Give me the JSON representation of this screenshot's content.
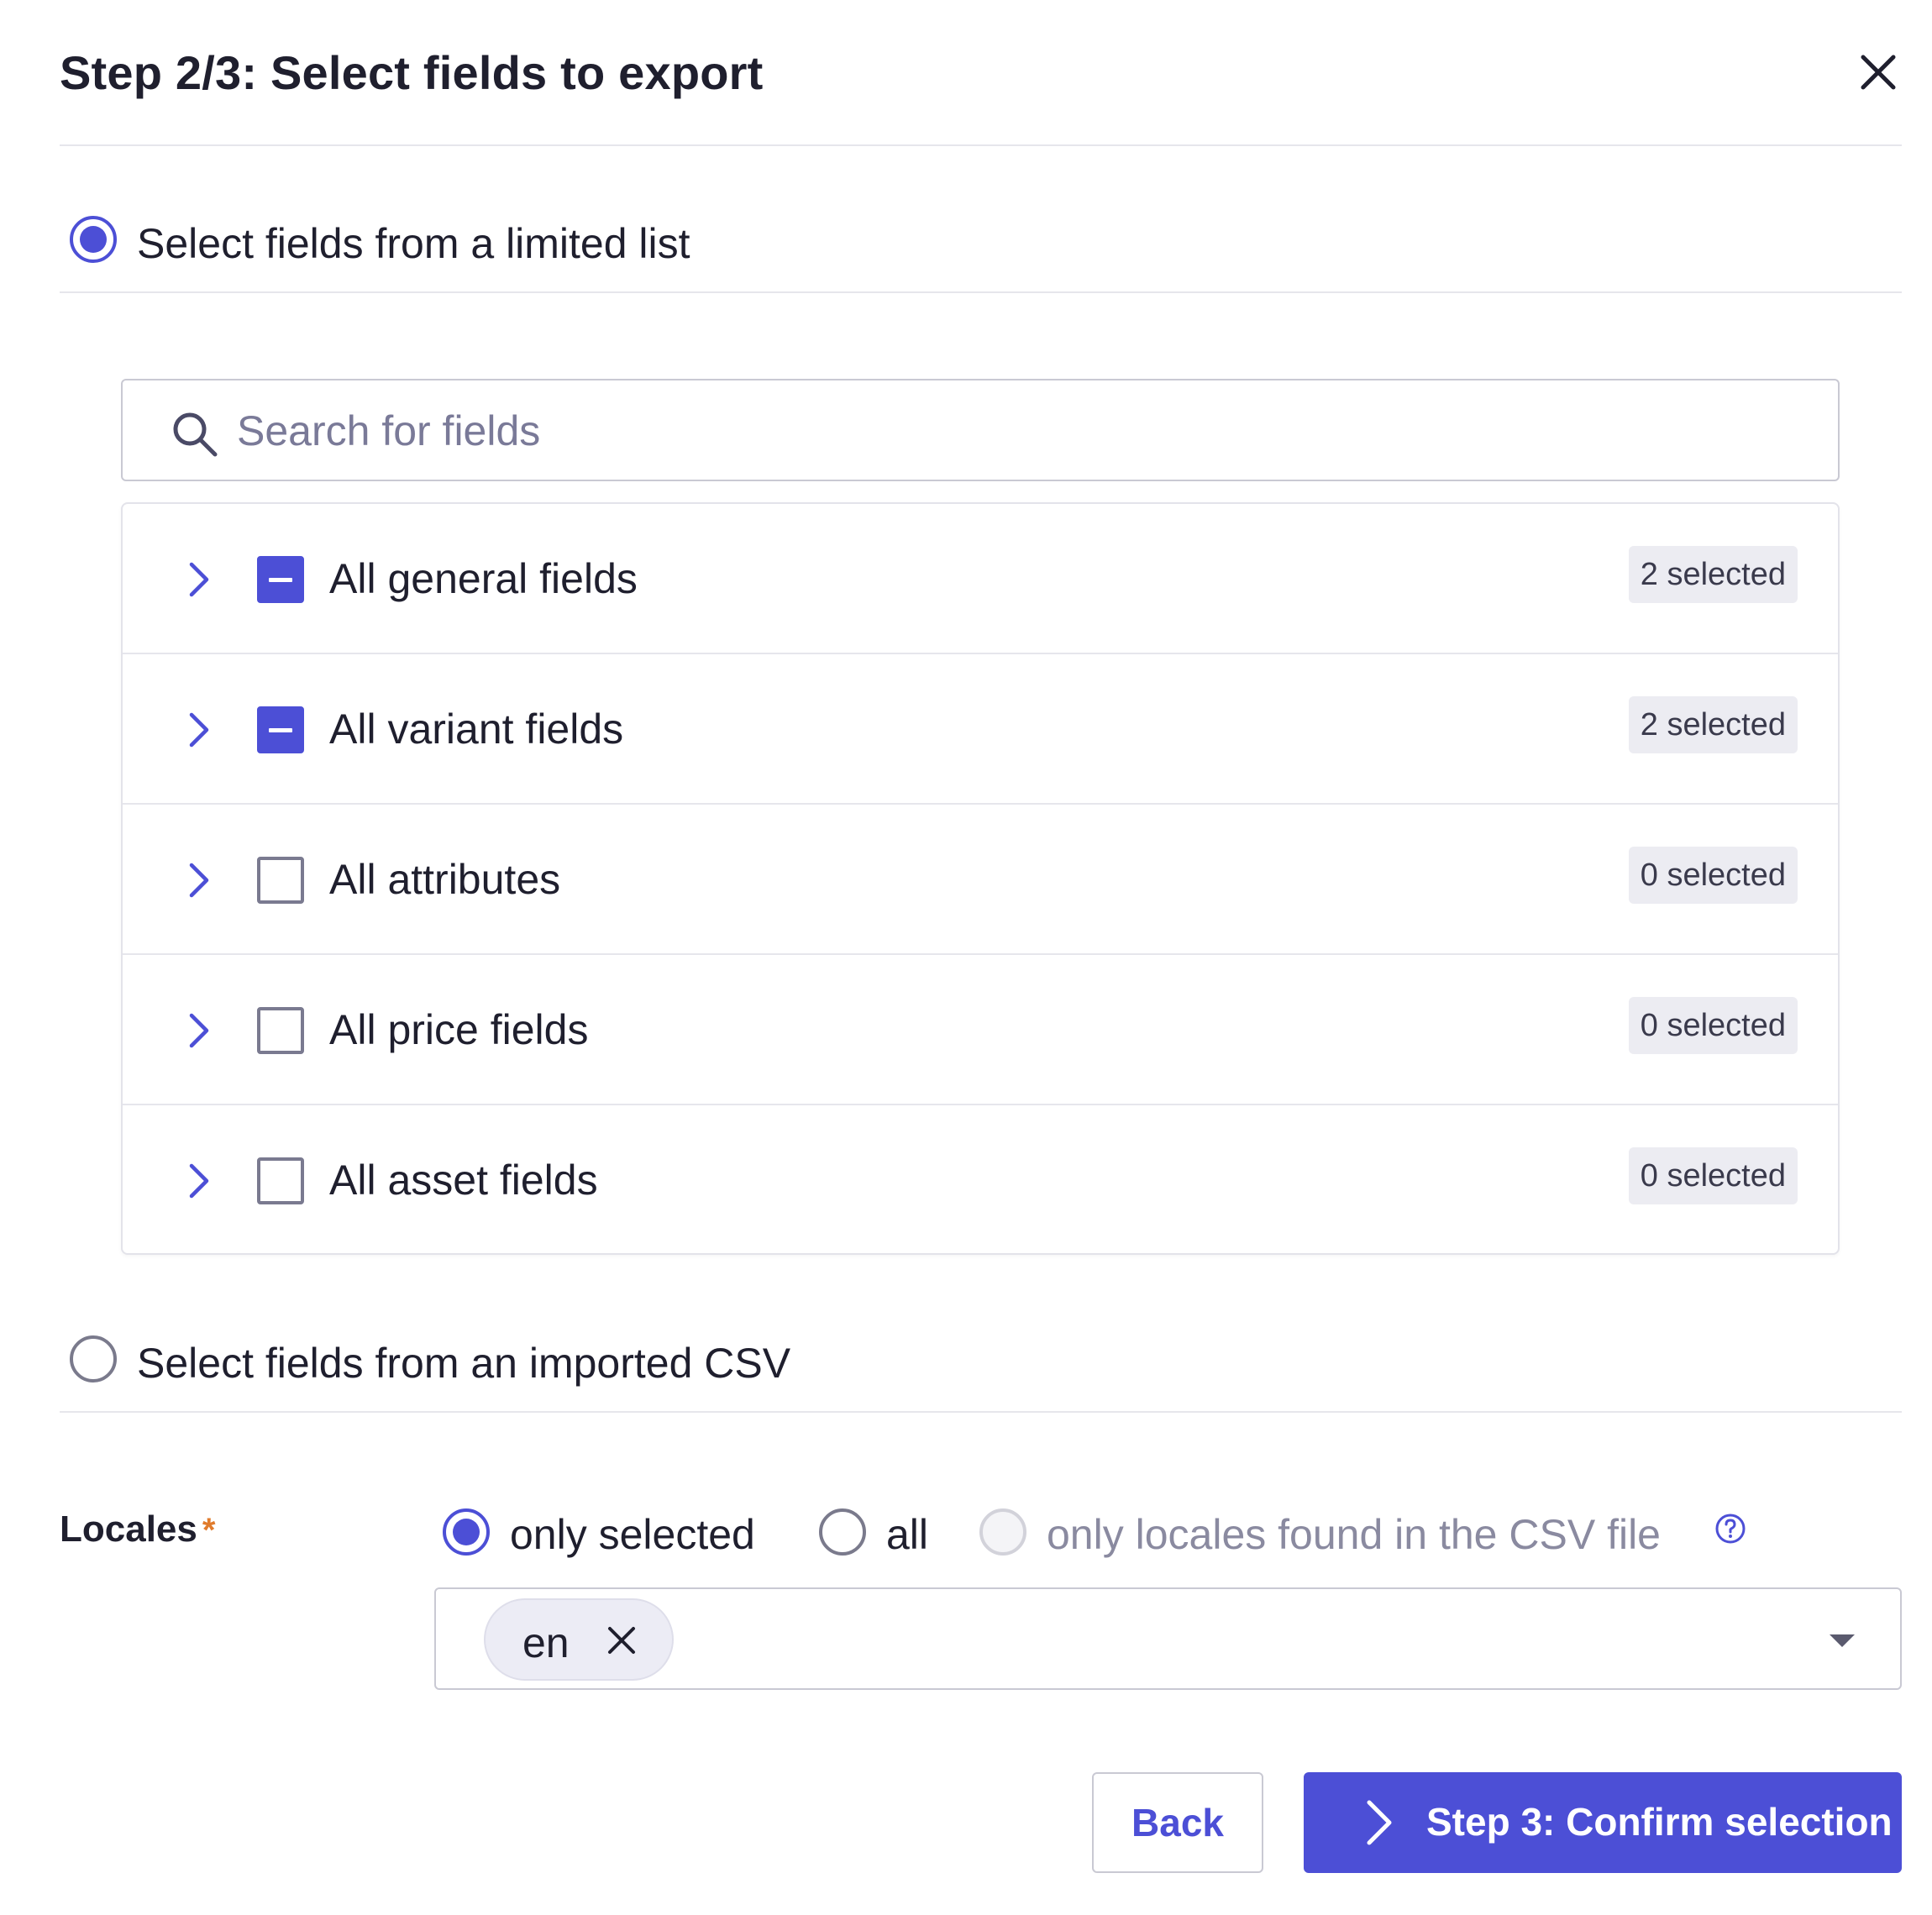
{
  "dialog": {
    "title": "Step 2/3: Select fields to export",
    "close_icon": "close-icon"
  },
  "mode_options": {
    "limited_list_label": "Select fields from a limited list",
    "limited_list_selected": true,
    "imported_csv_label": "Select fields from an imported CSV",
    "imported_csv_selected": false
  },
  "search": {
    "placeholder": "Search for fields",
    "value": "",
    "icon": "search-icon"
  },
  "field_groups": [
    {
      "label": "All general fields",
      "badge": "2 selected",
      "state": "partial"
    },
    {
      "label": "All variant fields",
      "badge": "2 selected",
      "state": "partial"
    },
    {
      "label": "All attributes",
      "badge": "0 selected",
      "state": "unchecked"
    },
    {
      "label": "All price fields",
      "badge": "0 selected",
      "state": "unchecked"
    },
    {
      "label": "All asset fields",
      "badge": "0 selected",
      "state": "unchecked"
    }
  ],
  "locales": {
    "label": "Locales",
    "required_mark": "*",
    "options": [
      {
        "label": "only selected",
        "selected": true,
        "disabled": false
      },
      {
        "label": "all",
        "selected": false,
        "disabled": false
      },
      {
        "label": "only locales found in the CSV file",
        "selected": false,
        "disabled": true
      }
    ],
    "selected_chips": [
      "en"
    ]
  },
  "footer": {
    "back_label": "Back",
    "next_label": "Step 3: Confirm selection"
  },
  "colors": {
    "accent": "#4c4fd6",
    "required": "#e07b2c",
    "border": "#c9c9d3",
    "badge_bg": "#ececf2"
  }
}
